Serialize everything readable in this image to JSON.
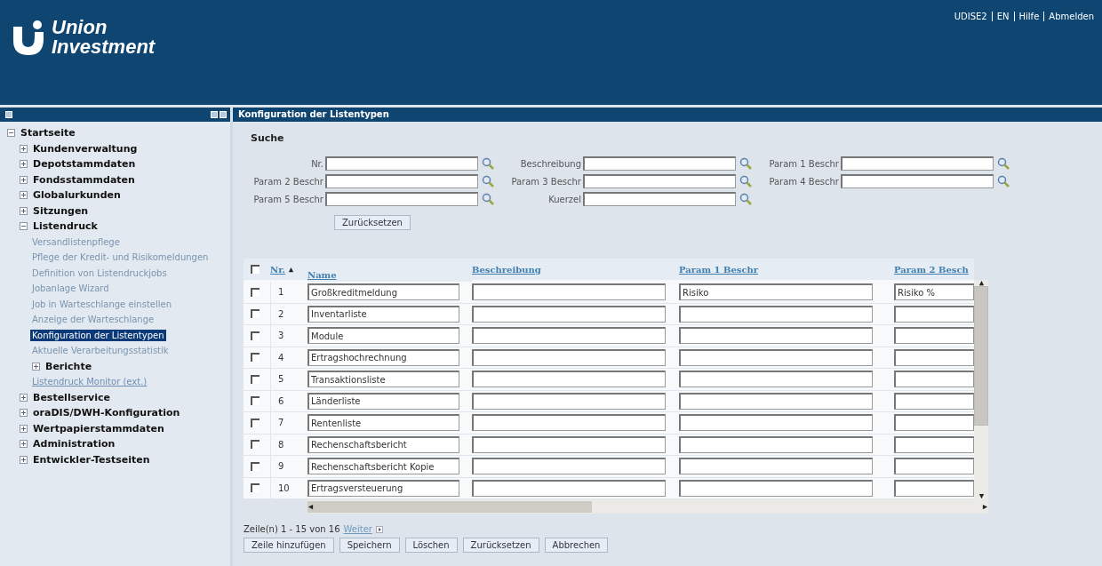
{
  "header": {
    "logo": {
      "line_1": "Union",
      "line_2": "Investment"
    },
    "links": [
      "UDISE2",
      "EN",
      "Hilfe",
      "Abmelden"
    ]
  },
  "page_title": "Konfiguration der Listentypen",
  "sidebar": {
    "items": [
      {
        "kind": "folder",
        "label": "Startseite",
        "expanded": true,
        "children": [
          {
            "kind": "folder",
            "label": "Kundenverwaltung",
            "expanded": false
          },
          {
            "kind": "folder",
            "label": "Depotstammdaten",
            "expanded": false
          },
          {
            "kind": "folder",
            "label": "Fondsstammdaten",
            "expanded": false
          },
          {
            "kind": "folder",
            "label": "Globalurkunden",
            "expanded": false
          },
          {
            "kind": "folder",
            "label": "Sitzungen",
            "expanded": false
          },
          {
            "kind": "folder",
            "label": "Listendruck",
            "expanded": true,
            "children": [
              {
                "kind": "page",
                "label": "Versandlistenpflege",
                "selected": false
              },
              {
                "kind": "page",
                "label": "Pflege der Kredit- und Risikomeldungen",
                "selected": false
              },
              {
                "kind": "page",
                "label": "Definition von Listendruckjobs",
                "selected": false
              },
              {
                "kind": "page",
                "label": "Jobanlage Wizard",
                "selected": false
              },
              {
                "kind": "page",
                "label": "Job in Warteschlange einstellen",
                "selected": false
              },
              {
                "kind": "page",
                "label": "Anzeige der Warteschlange",
                "selected": false
              },
              {
                "kind": "page",
                "label": "Konfiguration der Listentypen",
                "selected": true
              },
              {
                "kind": "page",
                "label": "Aktuelle Verarbeitungsstatistik",
                "selected": false
              },
              {
                "kind": "folder",
                "label": "Berichte",
                "expanded": false
              },
              {
                "kind": "link",
                "label": "Listendruck Monitor (ext.)"
              }
            ]
          },
          {
            "kind": "folder",
            "label": "Bestellservice",
            "expanded": false
          },
          {
            "kind": "folder",
            "label": "oraDIS/DWH-Konfiguration",
            "expanded": false
          },
          {
            "kind": "folder",
            "label": "Wertpapierstammdaten",
            "expanded": false
          },
          {
            "kind": "folder",
            "label": "Administration",
            "expanded": false
          },
          {
            "kind": "folder",
            "label": "Entwickler-Testseiten",
            "expanded": false
          }
        ]
      }
    ]
  },
  "search": {
    "title": "Suche",
    "fields": [
      {
        "label": "Nr."
      },
      {
        "label": "Beschreibung"
      },
      {
        "label": "Param 1 Beschr"
      },
      {
        "label": "Param 2 Beschr"
      },
      {
        "label": "Param 3 Beschr"
      },
      {
        "label": "Param 4 Beschr"
      },
      {
        "label": "Param 5 Beschr"
      },
      {
        "label": "Kuerzel"
      }
    ],
    "reset_button": "Zurücksetzen"
  },
  "table": {
    "select_all_checked": false,
    "columns": [
      "Nr.",
      "Name",
      "Beschreibung",
      "Param 1 Beschr",
      "Param 2 Besch"
    ],
    "rows": [
      {
        "checked": false,
        "nr": "1",
        "name": "Großkreditmeldung",
        "param_1": "Risiko",
        "param_2": "Risiko %"
      },
      {
        "checked": false,
        "nr": "2",
        "name": "Inventarliste"
      },
      {
        "checked": false,
        "nr": "3",
        "name": "Module"
      },
      {
        "checked": false,
        "nr": "4",
        "name": "Ertragshochrechnung"
      },
      {
        "checked": false,
        "nr": "5",
        "name": "Transaktionsliste"
      },
      {
        "checked": false,
        "nr": "6",
        "name": "Länderliste"
      },
      {
        "checked": false,
        "nr": "7",
        "name": "Rentenliste"
      },
      {
        "checked": false,
        "nr": "8",
        "name": "Rechenschaftsbericht"
      },
      {
        "checked": false,
        "nr": "9",
        "name": "Rechenschaftsbericht Kopie"
      },
      {
        "checked": false,
        "nr": "10",
        "name": "Ertragsversteuerung"
      }
    ]
  },
  "pagination": {
    "summary": "Zeile(n) 1 - 15 von 16",
    "next": "Weiter"
  },
  "buttons": [
    "Zeile hinzufügen",
    "Speichern",
    "Löschen",
    "Zurücksetzen",
    "Abbrechen"
  ]
}
